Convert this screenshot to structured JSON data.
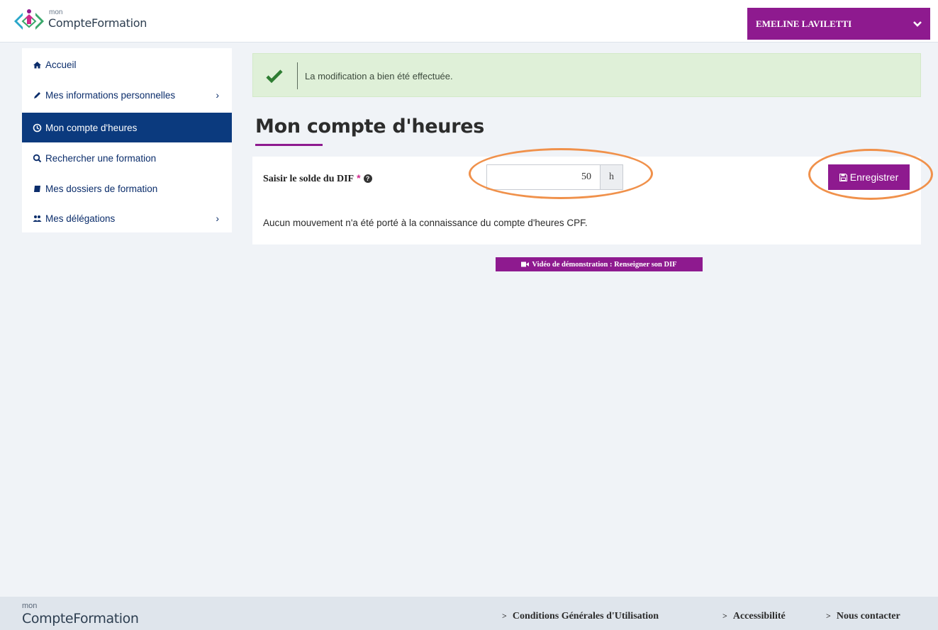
{
  "header": {
    "logo_mon": "mon",
    "logo_name": "CompteFormation",
    "user_name": "EMELINE LAVILETTI"
  },
  "sidebar": {
    "items": [
      {
        "label": "Accueil",
        "icon": "home-icon"
      },
      {
        "label": "Mes informations personnelles",
        "icon": "pencil-icon"
      },
      {
        "label": "Mon compte d'heures",
        "icon": "clock-icon"
      },
      {
        "label": "Rechercher une formation",
        "icon": "search-icon"
      },
      {
        "label": "Mes dossiers de formation",
        "icon": "book-icon"
      },
      {
        "label": "Mes délégations",
        "icon": "users-icon"
      }
    ]
  },
  "alert": {
    "message": "La modification a bien été effectuée."
  },
  "main": {
    "title": "Mon compte d'heures",
    "dif_label": "Saisir le solde du DIF",
    "required_mark": "*",
    "dif_value": "50",
    "unit": "h",
    "save_label": "Enregistrer",
    "no_movement": "Aucun mouvement n'a été porté à la connaissance du compte d'heures CPF.",
    "video_label": "Vidéo de démonstration : Renseigner son DIF"
  },
  "footer": {
    "logo_mon": "mon",
    "logo_name": "CompteFormation",
    "links": [
      "Conditions Générales d'Utilisation",
      "Accessibilité",
      "Nous contacter"
    ]
  },
  "colors": {
    "brand_purple": "#8e1a8f",
    "nav_active": "#0b3a7e",
    "alert_bg": "#dff0d8",
    "annotation_orange": "#f0914b"
  }
}
